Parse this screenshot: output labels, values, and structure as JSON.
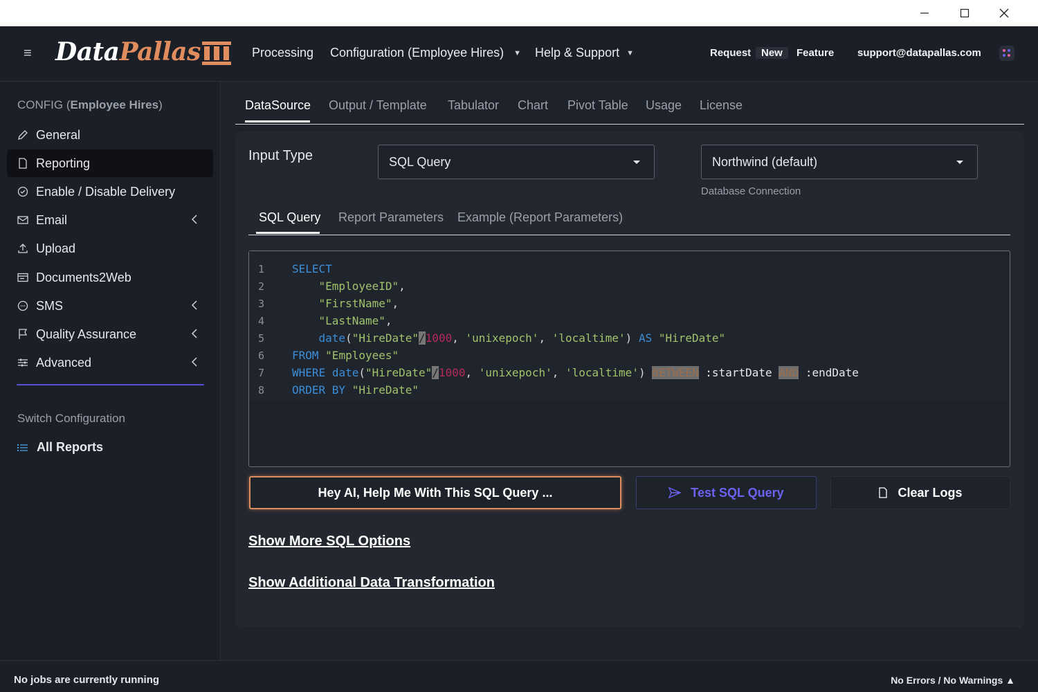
{
  "window": {
    "controls": [
      "minimize-icon",
      "maximize-icon",
      "close-icon"
    ]
  },
  "topnav": {
    "logo_word1": "Data",
    "logo_word2": "Pallas",
    "items": [
      {
        "label": "Processing"
      },
      {
        "label": "Configuration (Employee Hires)"
      },
      {
        "label": "Help & Support"
      }
    ],
    "right": {
      "request": "Request",
      "new": "New",
      "feature": "Feature",
      "email": "support@datapallas.com"
    },
    "brand_colors": {
      "logo_accent": "#e08c5f",
      "accent": "#5a50d8"
    }
  },
  "sidebar": {
    "config_prefix": "CONFIG (",
    "config_name": "Employee Hires",
    "config_suffix": ")",
    "items": [
      {
        "label": "General",
        "icon": "pencil-icon"
      },
      {
        "label": "Reporting",
        "icon": "document-icon",
        "active": true
      },
      {
        "label": "Enable / Disable Delivery",
        "icon": "check-circle-icon"
      },
      {
        "label": "Email",
        "icon": "mail-icon",
        "expandable": true
      },
      {
        "label": "Upload",
        "icon": "upload-icon"
      },
      {
        "label": "Documents2Web",
        "icon": "browser-icon"
      },
      {
        "label": "SMS",
        "icon": "chat-icon",
        "expandable": true
      },
      {
        "label": "Quality Assurance",
        "icon": "flag-icon",
        "expandable": true
      },
      {
        "label": "Advanced",
        "icon": "sliders-icon",
        "expandable": true
      }
    ],
    "switch_label": "Switch Configuration",
    "all_reports": "All Reports"
  },
  "tabs": [
    {
      "label": "DataSource",
      "active": true
    },
    {
      "label": "Output / Template"
    },
    {
      "label": "Tabulator"
    },
    {
      "label": "Chart"
    },
    {
      "label": "Pivot Table"
    },
    {
      "label": "Usage"
    },
    {
      "label": "License"
    }
  ],
  "datasource": {
    "input_type_label": "Input Type",
    "input_type_value": "SQL Query",
    "connection_value": "Northwind (default)",
    "connection_label": "Database Connection",
    "subtabs": [
      {
        "label": "SQL Query",
        "active": true
      },
      {
        "label": "Report Parameters"
      },
      {
        "label": "Example (Report Parameters)"
      }
    ],
    "sql_lines": [
      "SELECT",
      "    \"EmployeeID\",",
      "    \"FirstName\",",
      "    \"LastName\",",
      "    date(\"HireDate\"/1000, 'unixepoch', 'localtime') AS \"HireDate\"",
      "FROM \"Employees\"",
      "WHERE date(\"HireDate\"/1000, 'unixepoch', 'localtime') BETWEEN :startDate AND :endDate",
      "ORDER BY \"HireDate\""
    ],
    "buttons": {
      "ai": "Hey AI, Help Me With This SQL Query ...",
      "test": "Test SQL Query",
      "clear": "Clear Logs"
    },
    "links": {
      "more_sql": "Show More SQL Options",
      "transform": "Show Additional Data Transformation"
    }
  },
  "status": {
    "left": "No jobs are currently running",
    "right": "No Errors / No Warnings ▲"
  }
}
